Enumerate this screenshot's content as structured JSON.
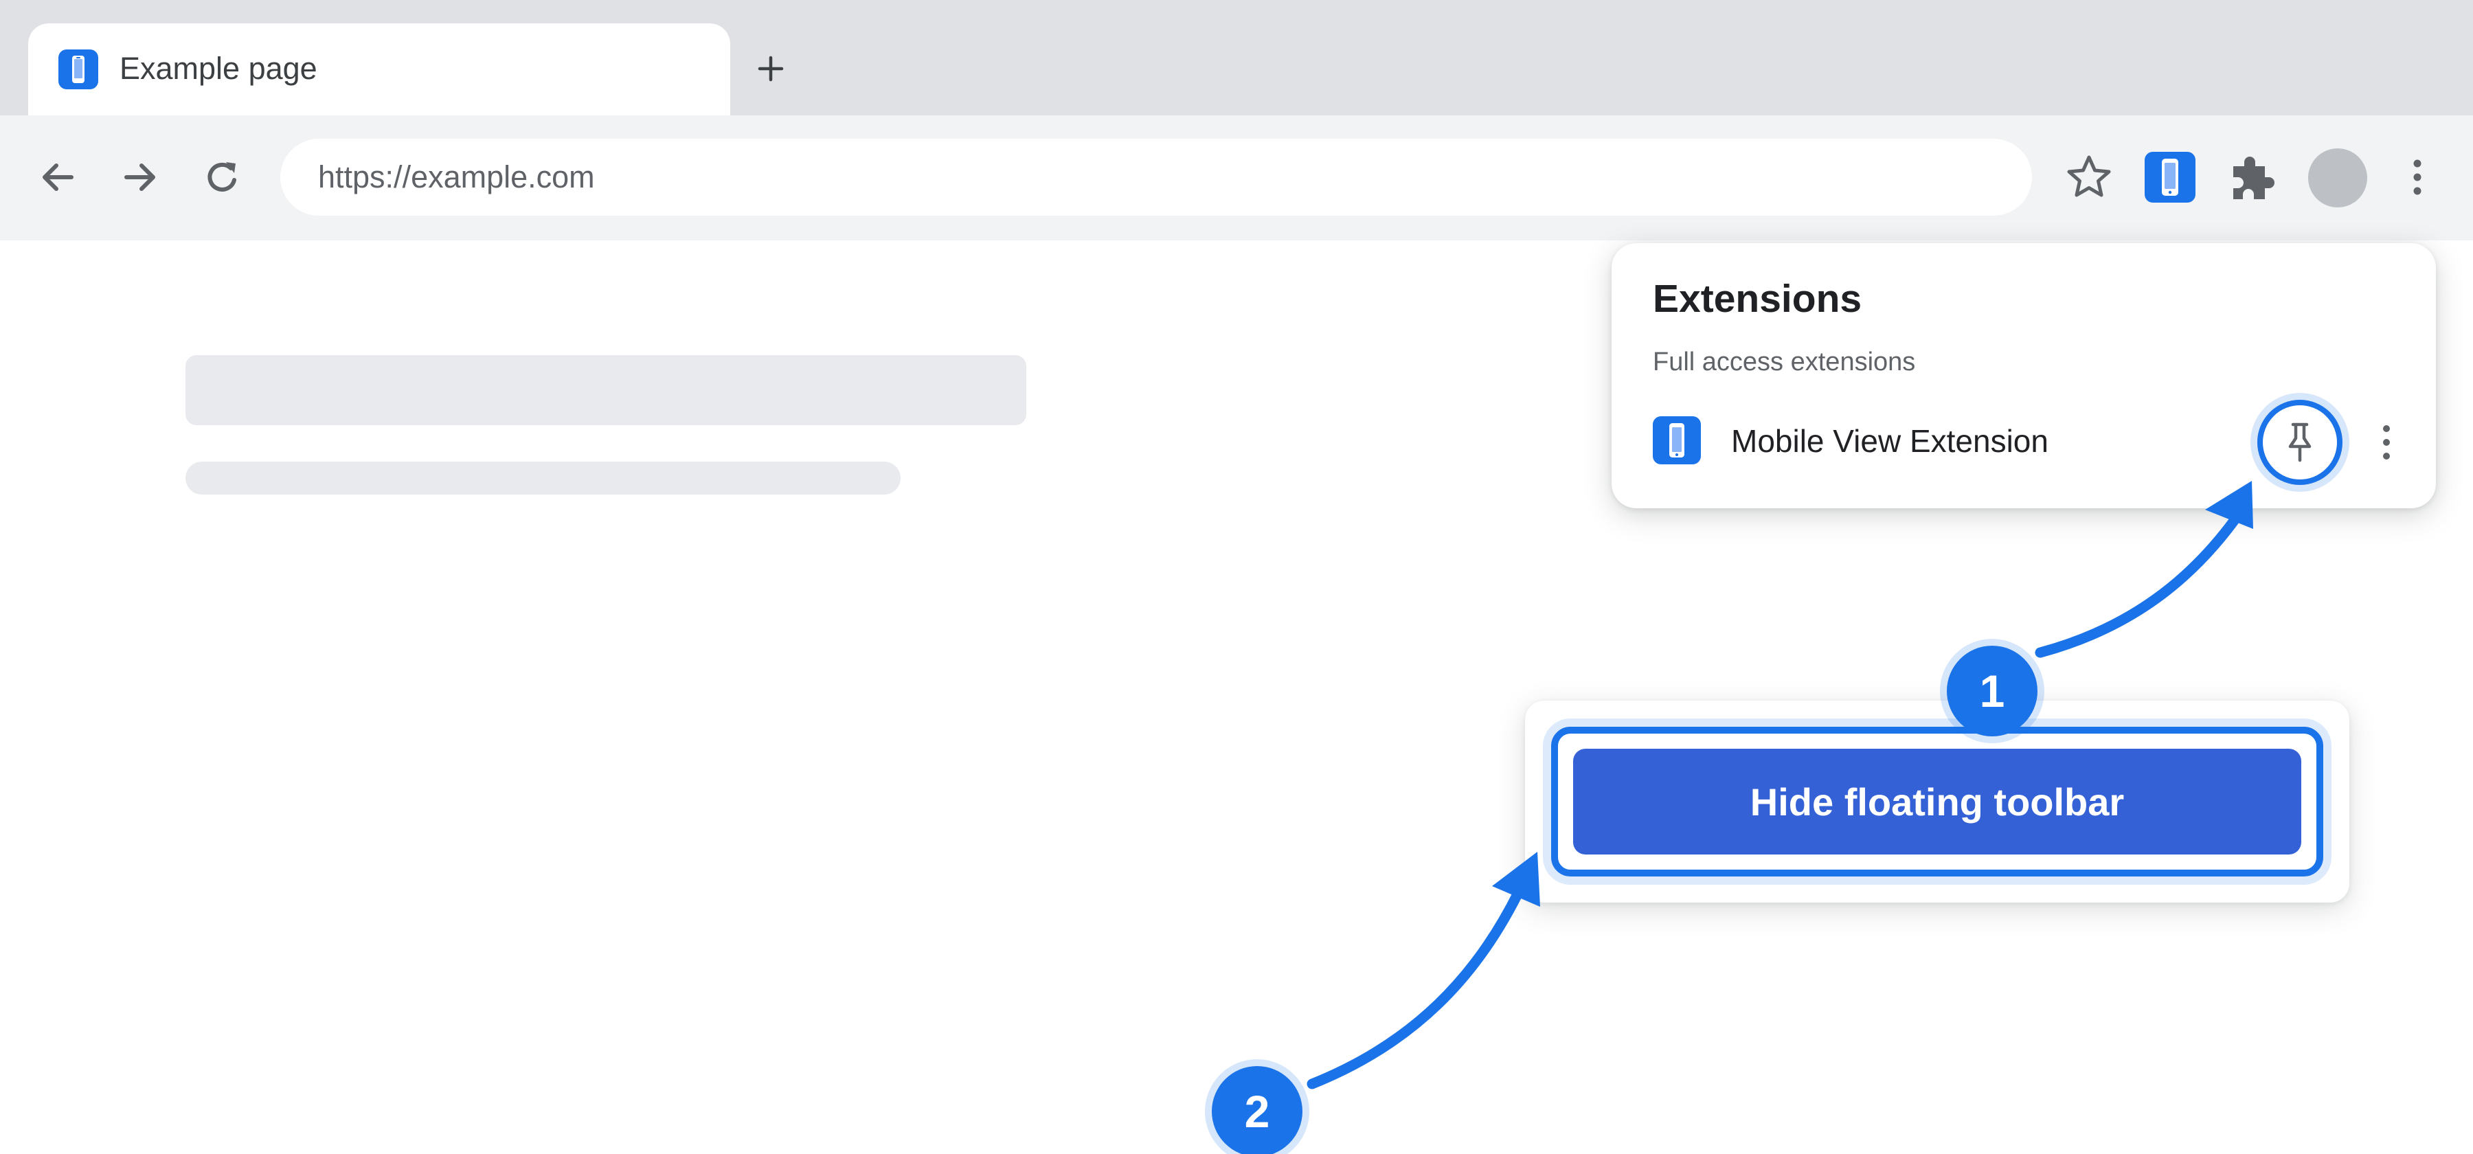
{
  "colors": {
    "accent": "#1a73e8",
    "button_fill": "#3461d6",
    "tabstrip_bg": "#dfe1e5",
    "toolbar_bg": "#f1f3f4",
    "skeleton": "#e8eaed"
  },
  "tab": {
    "title": "Example page",
    "favicon": "mobile-phone-icon",
    "new_tab_icon": "plus-icon"
  },
  "toolbar": {
    "url": "https://example.com",
    "icons": [
      "back-arrow-icon",
      "forward-arrow-icon",
      "reload-icon",
      "bookmark-star-icon",
      "mobile-view-extension-icon",
      "extensions-puzzle-icon",
      "profile-avatar",
      "more-vert-icon"
    ]
  },
  "extensions_popup": {
    "title": "Extensions",
    "section_label": "Full access extensions",
    "items": [
      {
        "name": "Mobile View Extension",
        "icon": "mobile-phone-icon",
        "pin_icon": "pin-icon",
        "more_icon": "more-vert-icon"
      }
    ]
  },
  "floating_toolbar": {
    "button_label": "Hide floating toolbar"
  },
  "steps": [
    {
      "number": "1"
    },
    {
      "number": "2"
    }
  ]
}
